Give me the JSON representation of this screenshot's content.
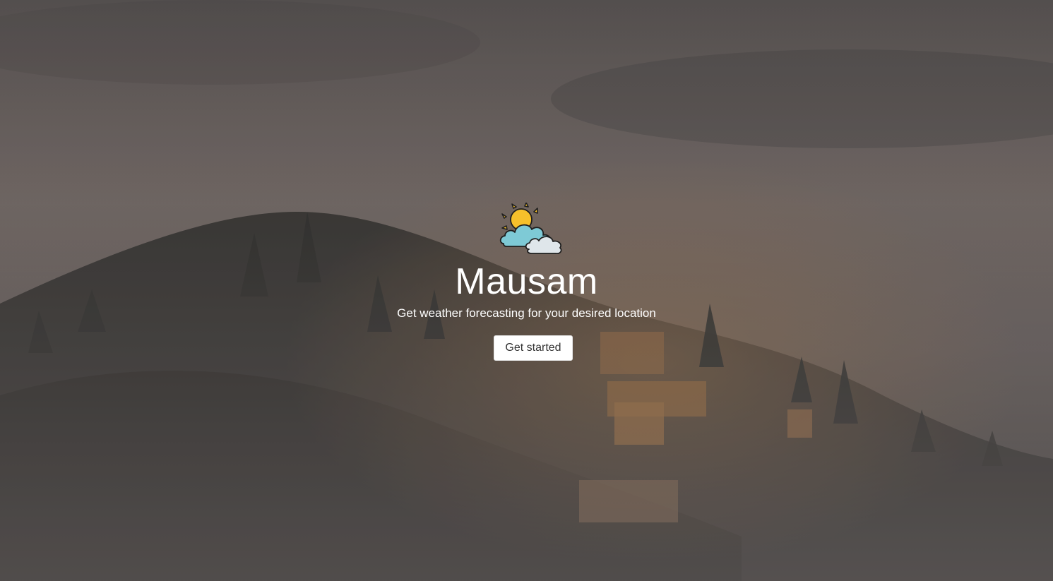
{
  "hero": {
    "title": "Mausam",
    "subtitle": "Get weather forecasting for your desired location",
    "cta_label": "Get started",
    "logo_icon": "partly-cloudy-sun-icon",
    "background": "foggy-hillside-village-photo"
  },
  "colors": {
    "sun": "#f6c02b",
    "cloud_front": "#7ecad6",
    "cloud_back": "#dfe6ea",
    "outline": "#1f1f1f",
    "text": "#ffffff",
    "button_bg": "#ffffff",
    "button_text": "#333333"
  }
}
